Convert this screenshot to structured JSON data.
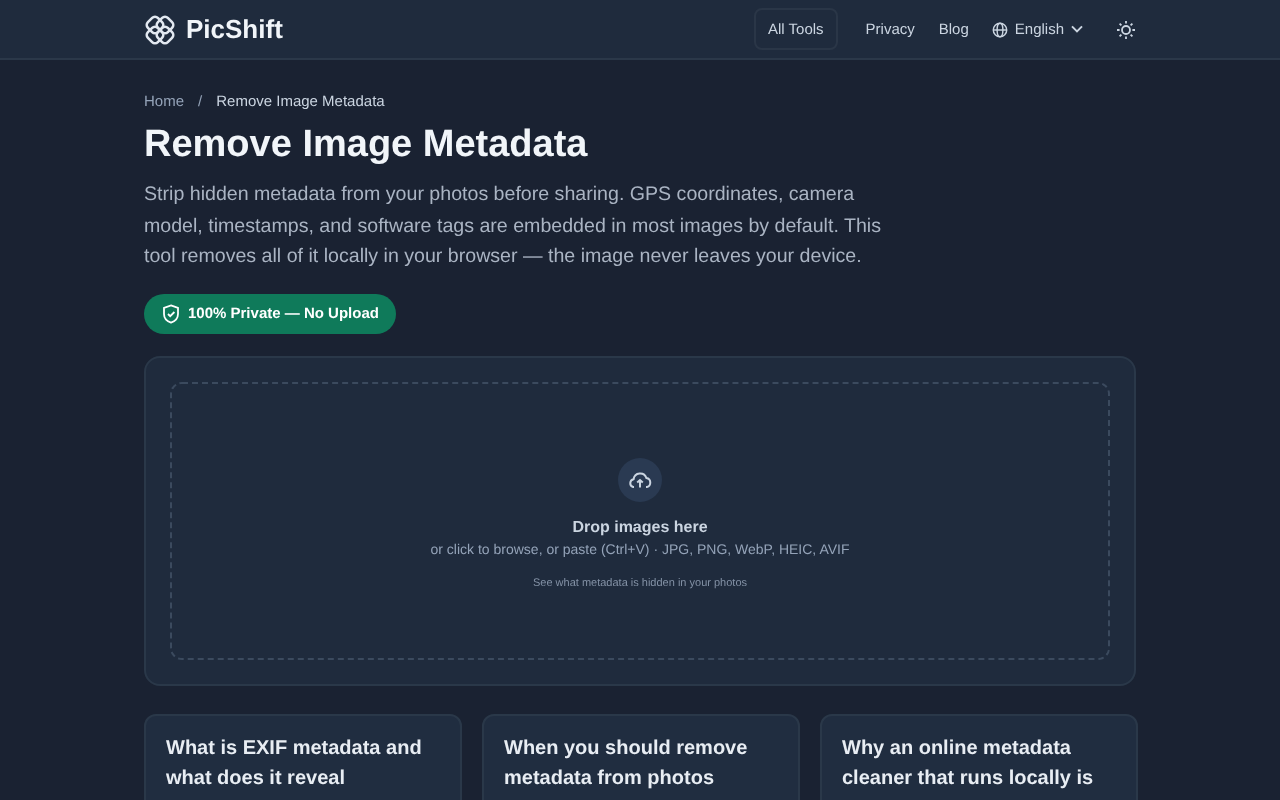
{
  "header": {
    "brand": "PicShift",
    "nav": [
      {
        "label": "All Tools",
        "selected": true
      },
      {
        "label": "Privacy",
        "selected": false
      },
      {
        "label": "Blog",
        "selected": false
      }
    ],
    "language": "English"
  },
  "breadcrumb": [
    "Home",
    "Remove Image Metadata"
  ],
  "breadcrumb_separator": "/",
  "title": "Remove Image Metadata",
  "description": "Strip hidden metadata from your photos before sharing. GPS coordinates, camera model, timestamps, and software tags are embedded in most images by default. This tool removes all of it locally in your browser — the image never leaves your device.",
  "badge": "100% Private — No Upload",
  "dropzone": {
    "title": "Drop images here",
    "subtitle": "or click to browse, or paste (Ctrl+V) · JPG, PNG, WebP, HEIC, AVIF",
    "hint": "See what metadata is hidden in your photos"
  },
  "cards": [
    {
      "title": "What is EXIF metadata and what does it reveal"
    },
    {
      "title": "When you should remove metadata from photos"
    },
    {
      "title": "Why an online metadata cleaner that runs locally is"
    }
  ]
}
